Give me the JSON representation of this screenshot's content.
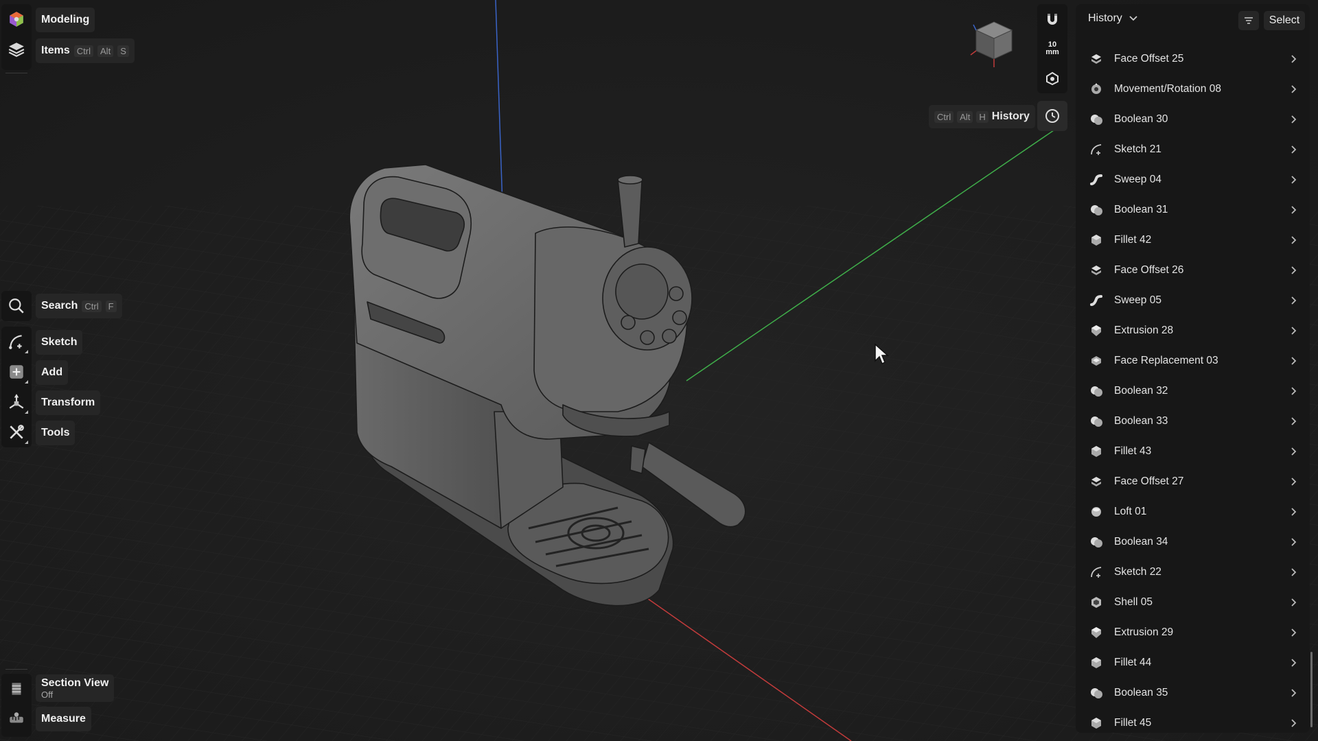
{
  "left_toolbar": {
    "mode_label": "Modeling",
    "items_label": "Items",
    "items_keys": [
      "Ctrl",
      "Alt",
      "S"
    ],
    "search_label": "Search",
    "search_keys": [
      "Ctrl",
      "F"
    ],
    "tools": [
      {
        "label": "Sketch",
        "icon": "sketch-icon"
      },
      {
        "label": "Add",
        "icon": "add-icon"
      },
      {
        "label": "Transform",
        "icon": "transform-icon"
      },
      {
        "label": "Tools",
        "icon": "tools-icon"
      }
    ],
    "section_view_label": "Section View",
    "section_view_state": "Off",
    "measure_label": "Measure"
  },
  "right_toolbar": {
    "units_value": "10",
    "units_unit": "mm",
    "history_hint_label": "History",
    "history_hint_keys": [
      "Ctrl",
      "Alt",
      "H"
    ]
  },
  "history_panel": {
    "title": "History",
    "select_label": "Select",
    "items": [
      {
        "label": "Face Offset 25",
        "icon": "face-offset-icon"
      },
      {
        "label": "Movement/Rotation 08",
        "icon": "movement-icon"
      },
      {
        "label": "Boolean 30",
        "icon": "boolean-icon"
      },
      {
        "label": "Sketch 21",
        "icon": "sketch-icon"
      },
      {
        "label": "Sweep 04",
        "icon": "sweep-icon"
      },
      {
        "label": "Boolean 31",
        "icon": "boolean-icon"
      },
      {
        "label": "Fillet 42",
        "icon": "fillet-icon"
      },
      {
        "label": "Face Offset 26",
        "icon": "face-offset-icon"
      },
      {
        "label": "Sweep 05",
        "icon": "sweep-icon"
      },
      {
        "label": "Extrusion 28",
        "icon": "extrusion-icon"
      },
      {
        "label": "Face Replacement 03",
        "icon": "face-replacement-icon"
      },
      {
        "label": "Boolean 32",
        "icon": "boolean-icon"
      },
      {
        "label": "Boolean 33",
        "icon": "boolean-icon"
      },
      {
        "label": "Fillet 43",
        "icon": "fillet-icon"
      },
      {
        "label": "Face Offset 27",
        "icon": "face-offset-icon"
      },
      {
        "label": "Loft 01",
        "icon": "loft-icon"
      },
      {
        "label": "Boolean 34",
        "icon": "boolean-icon"
      },
      {
        "label": "Sketch 22",
        "icon": "sketch-icon"
      },
      {
        "label": "Shell 05",
        "icon": "shell-icon"
      },
      {
        "label": "Extrusion 29",
        "icon": "extrusion-icon"
      },
      {
        "label": "Fillet 44",
        "icon": "fillet-icon"
      },
      {
        "label": "Boolean 35",
        "icon": "boolean-icon"
      },
      {
        "label": "Fillet 45",
        "icon": "fillet-icon"
      }
    ]
  },
  "colors": {
    "axis_x": "#c23b3b",
    "axis_y": "#3fae4a",
    "axis_z": "#3a64c8",
    "model_fill": "#5e5e5e"
  }
}
